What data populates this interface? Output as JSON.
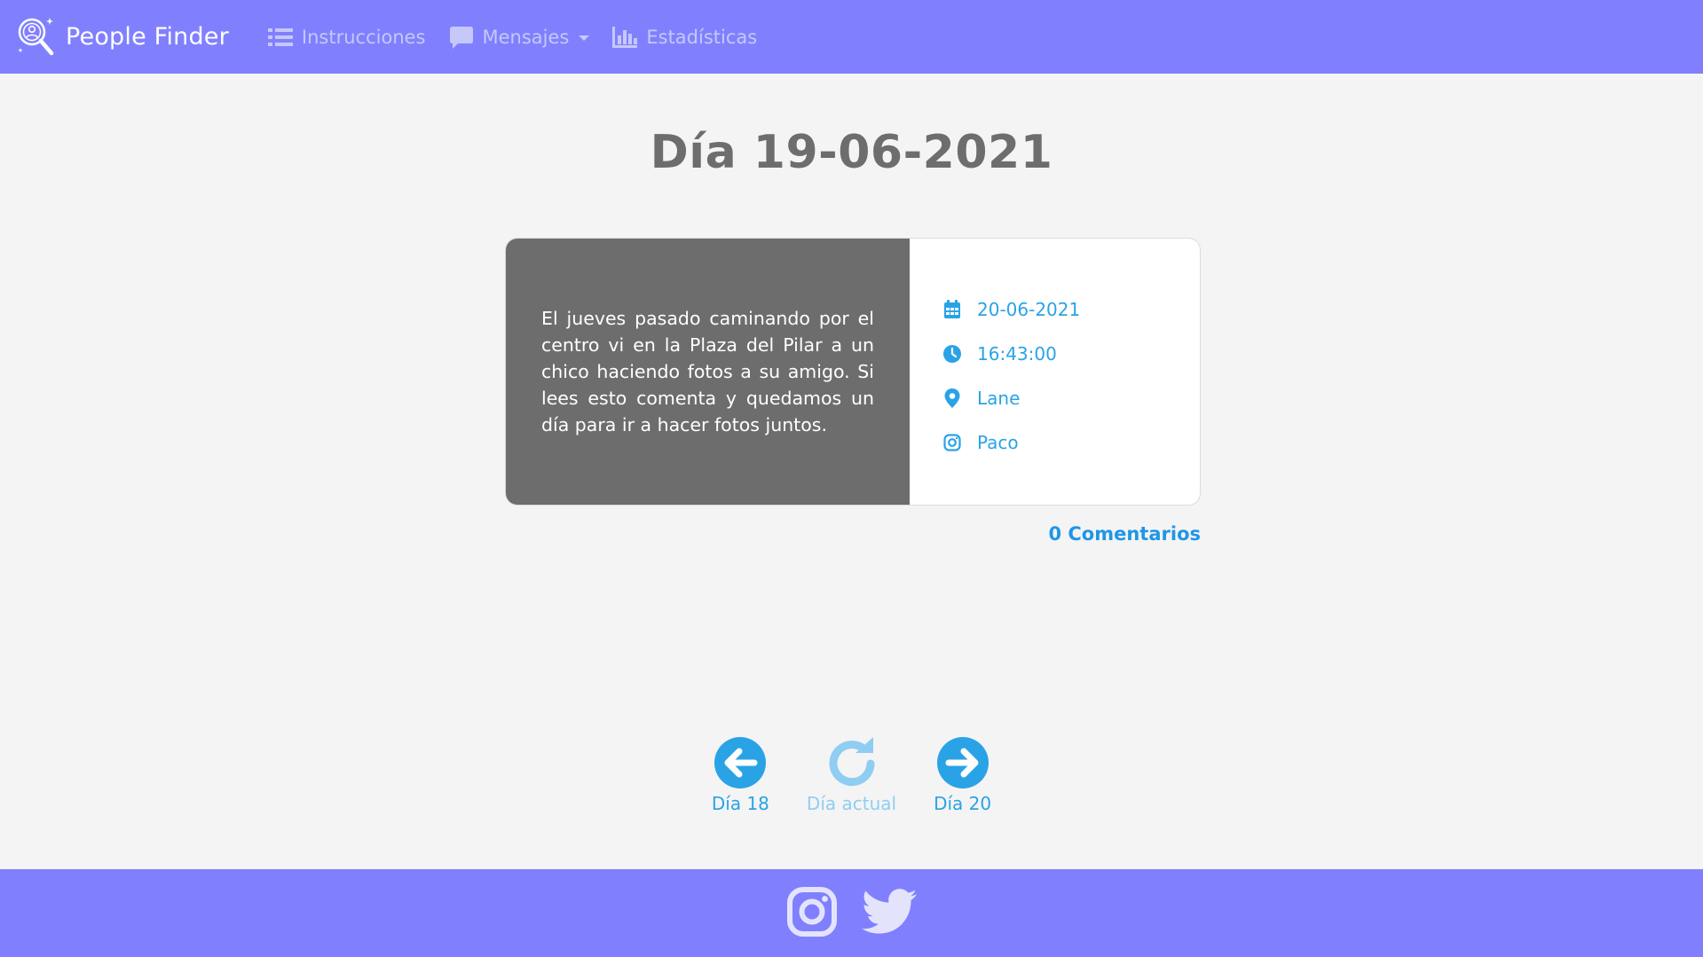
{
  "navbar": {
    "brand": "People Finder",
    "links": [
      {
        "label": "Instrucciones",
        "icon": "list-icon"
      },
      {
        "label": "Mensajes",
        "icon": "comment-icon",
        "dropdown": true
      },
      {
        "label": "Estadísticas",
        "icon": "bar-chart-icon"
      }
    ]
  },
  "page": {
    "title": "Día 19-06-2021"
  },
  "message": {
    "text": "El jueves pasado caminando por el centro vi en la Plaza del Pilar a un chico haciendo fotos a su amigo. Si lees esto comenta y quedamos un día para ir a hacer fotos juntos.",
    "date": "20-06-2021",
    "time": "16:43:00",
    "place": "Lane",
    "instagram": "Paco",
    "comments_link": "0 Comentarios"
  },
  "day_nav": {
    "prev_label": "Día 18",
    "current_label": "Día actual",
    "next_label": "Día 20"
  },
  "footer": {
    "social": [
      "instagram-icon",
      "twitter-icon"
    ]
  },
  "colors": {
    "navbar": "#8080ff",
    "nav_link": "#c6c8f9",
    "accent_blue": "#2aa3e6",
    "current_light_blue": "#8fcdf2",
    "message_bg": "#6d6d6d",
    "title": "#6d6d6d",
    "page_bg": "#f4f4f4",
    "footer_icons": "#e3e4fb"
  }
}
